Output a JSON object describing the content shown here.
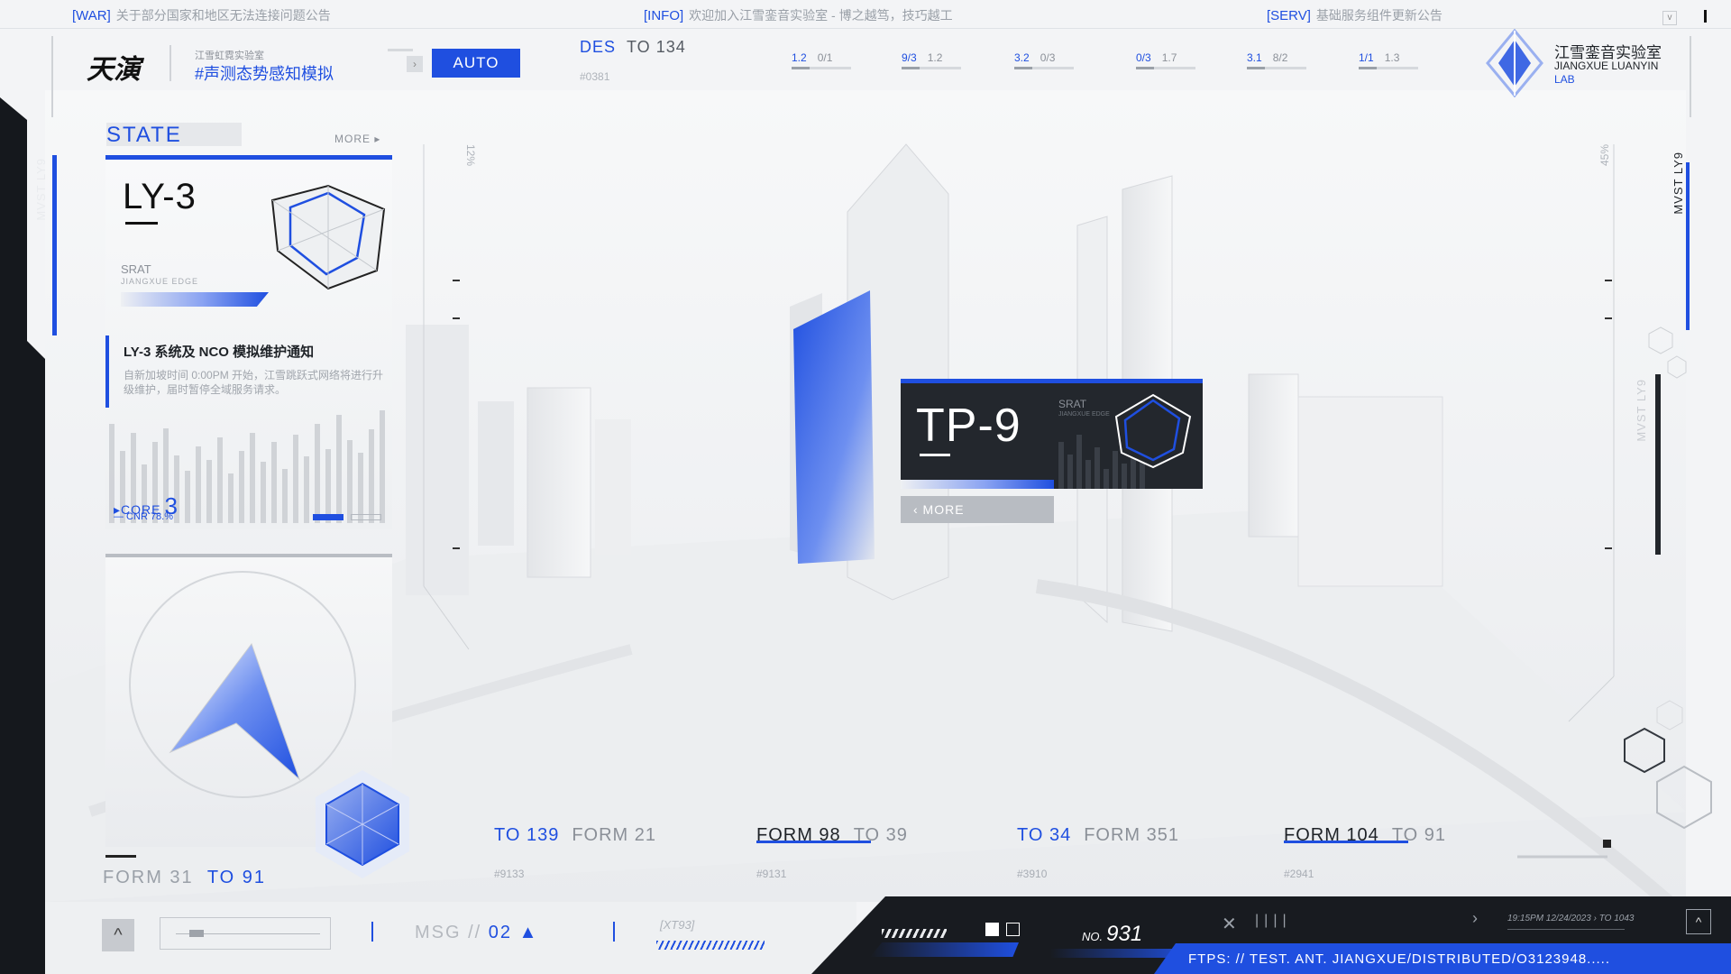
{
  "notices": [
    {
      "tag": "[WAR]",
      "text": "关于部分国家和地区无法连接问题公告"
    },
    {
      "tag": "[INFO]",
      "text": "欢迎加入江雪銮音实验室 - 博之越笃，技巧越工"
    },
    {
      "tag": "[SERV]",
      "text": "基础服务组件更新公告"
    }
  ],
  "header": {
    "logo_glyph": "天演",
    "lab_small": "江雪虹霓实验室",
    "hashtag_title": "#声测态势感知模拟",
    "auto_label": "AUTO",
    "des_left": "DES",
    "des_right": "TO 134",
    "des_sub": "#0381",
    "ratios": [
      {
        "a": "1.2",
        "b": "0/1"
      },
      {
        "a": "9/3",
        "b": "1.2"
      },
      {
        "a": "3.2",
        "b": "0/3"
      },
      {
        "a": "0/3",
        "b": "1.7"
      },
      {
        "a": "3.1",
        "b": "8/2"
      },
      {
        "a": "1/1",
        "b": "1.3"
      }
    ],
    "brand_cn": "江雪銮音实验室",
    "brand_en": "JIANGXUE LUANYIN",
    "brand_lab": "LAB"
  },
  "side_labels": {
    "left": "MVST LY9",
    "right": "MVST LY9",
    "right_faint": "MVST LY9"
  },
  "state": {
    "title": "STATE",
    "more": "MORE ▸",
    "unit": "LY-3",
    "srat": "SRAT",
    "srat_sub": "JIANGXUE EDGE",
    "notice_title": "LY-3 系统及 NCO 模拟维护通知",
    "notice_body": "自新加坡时间 0:00PM 开始，江雪跳跃式网络将进行升级维护，届时暂停全域服务请求。",
    "core_label": "▸CORE",
    "core_value": "3",
    "cnr": "— CNR 78.%"
  },
  "form_bottom": {
    "a": "FORM 31",
    "b": "TO 91"
  },
  "scene": {
    "pct_left": "12%",
    "pct_right": "45%",
    "tp9": {
      "title": "TP-9",
      "srat": "SRAT",
      "srat_sub": "JIANGXUE EDGE",
      "more": "‹ MORE"
    }
  },
  "bottom_stats": [
    {
      "a": "TO 139",
      "b": "FORM 21",
      "sub": "#9133",
      "blue_first": true
    },
    {
      "a": "FORM 98",
      "b": "TO 39",
      "sub": "#9131",
      "blue_first": true
    },
    {
      "a": "TO 34",
      "b": "FORM 351",
      "sub": "#3910",
      "blue_first": true
    },
    {
      "a": "FORM 104",
      "b": "TO 91",
      "sub": "#2941",
      "blue_first": true
    }
  ],
  "footer": {
    "msg_a": "MSG //",
    "msg_b": "02",
    "xt": "[XT93]",
    "no_label": "NO.",
    "no_value": "931",
    "timestamp": "19:15PM 12/24/2023 › TO 1043",
    "ftps": "FTPS: // TEST. ANT. JIANGXUE/DISTRIBUTED/O3123948.....",
    "pips": "||||"
  },
  "colors": {
    "accent": "#1f4fe0",
    "dark": "#181b20",
    "panel": "#f3f4f6"
  }
}
